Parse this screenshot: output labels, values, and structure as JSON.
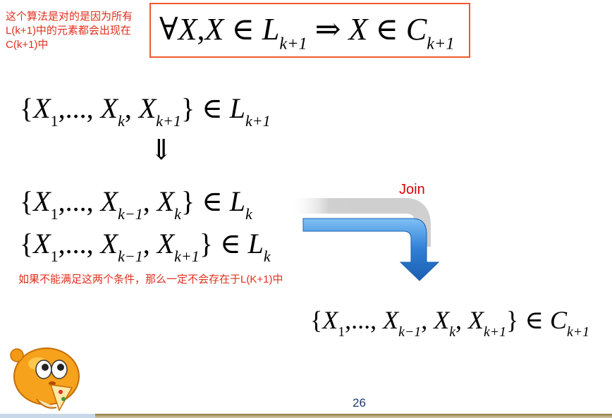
{
  "annotations": {
    "top_note": "这个算法是对的是因为所有L(k+1)中的元素都会出现在C(k+1)中",
    "middle_note": "如果不能满足这两个条件，那么一定不会存在于L(K+1)中"
  },
  "formulas": {
    "main": {
      "forall": "∀",
      "var1": "X",
      "comma": ",",
      "var2": "X",
      "in": " ∈ ",
      "set": "L",
      "sub": "k+1",
      "arrow": " ⇒ ",
      "var3": "X",
      "in2": " ∈ ",
      "set2": "C",
      "sub2": "k+1"
    },
    "line1": {
      "open": "{",
      "x1": "X",
      "s1": "1",
      "dots": ",..., ",
      "x2": "X",
      "s2": "k",
      "comma": ", ",
      "x3": "X",
      "s3": "k+1",
      "close": "}",
      "in": " ∈ ",
      "set": "L",
      "sub": "k+1"
    },
    "implies_down": "⇓",
    "line2": {
      "open": "{",
      "x1": "X",
      "s1": "1",
      "dots": ",..., ",
      "x2": "X",
      "s2": "k−1",
      "comma": ", ",
      "x3": "X",
      "s3": "k",
      "close": "}",
      "in": " ∈ ",
      "set": "L",
      "sub": "k"
    },
    "line3": {
      "open": "{",
      "x1": "X",
      "s1": "1",
      "dots": ",..., ",
      "x2": "X",
      "s2": "k−1",
      "comma": ", ",
      "x3": "X",
      "s3": "k+1",
      "close": "}",
      "in": " ∈ ",
      "set": "L",
      "sub": "k"
    },
    "line4": {
      "open": "{",
      "x1": "X",
      "s1": "1",
      "dots": ",..., ",
      "x2": "X",
      "s2": "k−1",
      "comma": ", ",
      "x3": "X",
      "s3": "k",
      "comma2": ", ",
      "x4": "X",
      "s4": "k+1",
      "close": "}",
      "in": " ∈ ",
      "set": "C",
      "sub": "k+1"
    }
  },
  "join_label": "Join",
  "page_number": "26",
  "colors": {
    "note_red": "#e0301e",
    "box_border": "#f0592a",
    "arrow_blue": "#2f7fd6",
    "page_number": "#1f3a6b"
  },
  "icons": {
    "mascot": "mushroom-mascot-icon",
    "join_arrow": "bent-down-arrow-icon"
  }
}
